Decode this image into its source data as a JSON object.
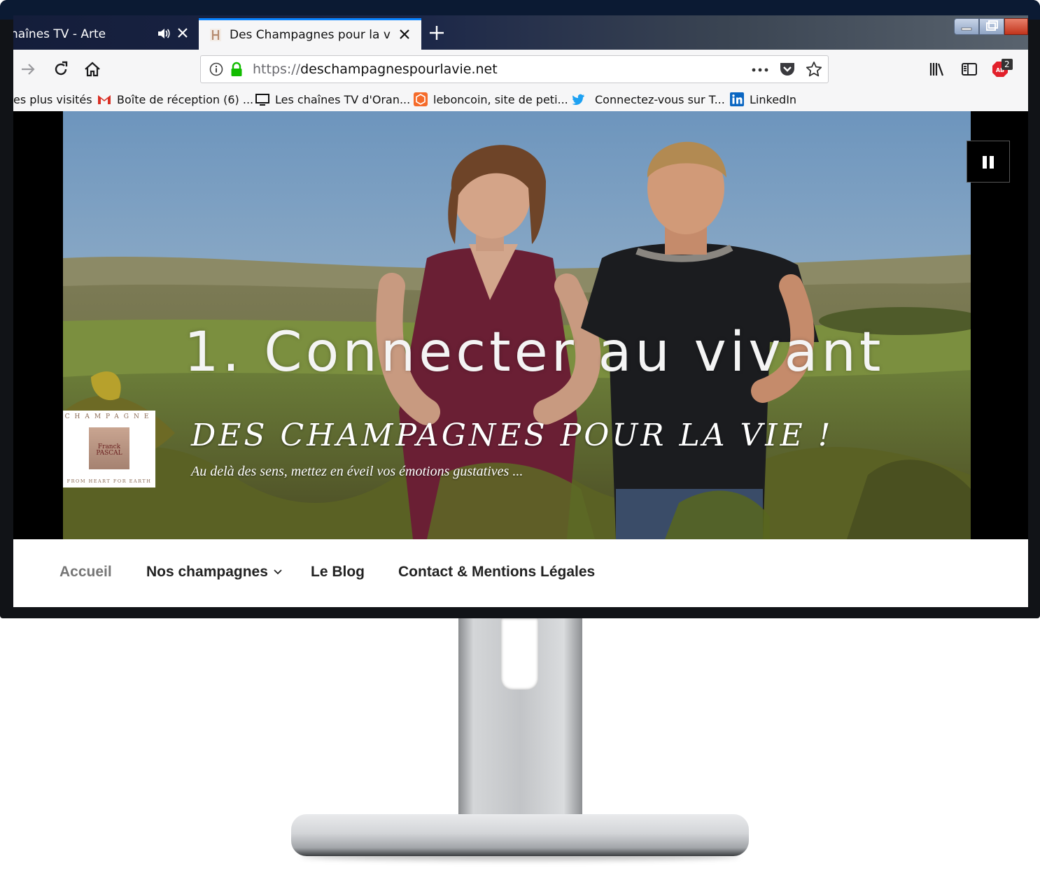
{
  "browser": {
    "tabs": [
      {
        "title": "haînes TV - Arte",
        "active": false,
        "muted_icon": "speaker-icon"
      },
      {
        "title": "Des Champagnes pour la vie ! -",
        "active": true,
        "favicon": "h-favicon-icon"
      }
    ],
    "url": {
      "protocol": "https://",
      "host": "deschampagnespourlavie.net"
    },
    "addon_badge_count": "2",
    "bookmarks": [
      {
        "label": "es plus visités",
        "icon": ""
      },
      {
        "label": "Boîte de réception (6) ...",
        "icon": "gmail-icon"
      },
      {
        "label": "Les chaînes TV d'Oran...",
        "icon": "tv-icon"
      },
      {
        "label": "leboncoin, site de peti...",
        "icon": "leboncoin-icon"
      },
      {
        "label": "Connectez-vous sur T...",
        "icon": "twitter-icon"
      },
      {
        "label": "LinkedIn",
        "icon": "linkedin-icon"
      }
    ]
  },
  "hero": {
    "video_caption": "1. Connecter au vivant",
    "logo": {
      "top_text": "CHAMPAGNE",
      "name_line1": "Franck",
      "name_line2": "PASCAL",
      "bottom_text": "FROM HEART FOR EARTH"
    },
    "site_title": "DES CHAMPAGNES POUR LA VIE !",
    "tagline": "Au delà des sens, mettez en éveil vos émotions gustatives ..."
  },
  "site_menu": {
    "items": [
      {
        "label": "Accueil",
        "current": true,
        "has_submenu": false
      },
      {
        "label": "Nos champagnes",
        "current": false,
        "has_submenu": true
      },
      {
        "label": "Le Blog",
        "current": false,
        "has_submenu": false
      },
      {
        "label": "Contact & Mentions Légales",
        "current": false,
        "has_submenu": false
      }
    ]
  },
  "colors": {
    "accent_blue": "#0a84ff",
    "secure_green": "#12bc00",
    "menu_current": "#767676",
    "menu_text": "#222222"
  }
}
